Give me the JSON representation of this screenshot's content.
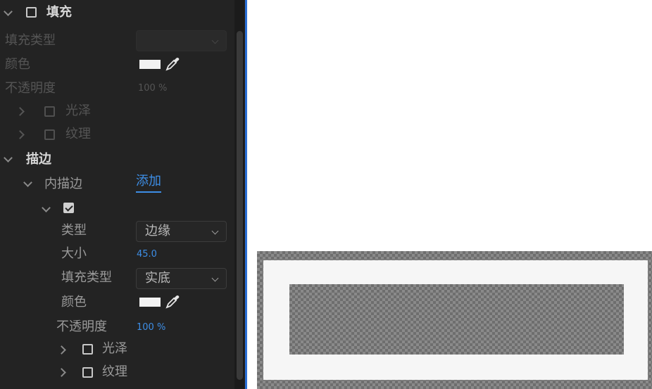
{
  "fill": {
    "title": "填充",
    "checked": false,
    "fill_type_label": "填充类型",
    "fill_type_value": "",
    "color_label": "颜色",
    "color_value": "#f2f2f2",
    "opacity_label": "不透明度",
    "opacity_value": "100 %",
    "sheen_label": "光泽",
    "texture_label": "纹理"
  },
  "stroke": {
    "title": "描边",
    "inner_stroke_label": "内描边",
    "add_link": "添加",
    "inner_checked": true,
    "type_label": "类型",
    "type_value": "边缘",
    "size_label": "大小",
    "size_value": "45.0",
    "fill_type_label": "填充类型",
    "fill_type_value": "实底",
    "color_label": "颜色",
    "color_value": "#f2f2f2",
    "opacity_label": "不透明度",
    "opacity_value": "100 %",
    "sheen_label": "光泽",
    "texture_label": "纹理"
  },
  "colors": {
    "panel_bg": "#232323",
    "accent_blue": "#3d8ee6",
    "preview_fill": "#f6f6f6"
  },
  "icons": {
    "chevron_down": "chevron-down-icon",
    "chevron_right": "chevron-right-icon",
    "eyedropper": "eyedropper-icon",
    "checkbox": "checkbox-icon"
  }
}
